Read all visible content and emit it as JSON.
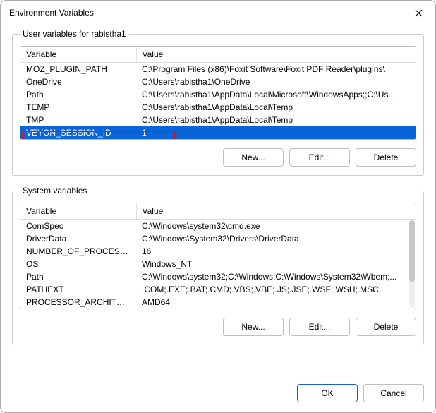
{
  "window": {
    "title": "Environment Variables"
  },
  "user_group": {
    "legend": "User variables for rabistha1",
    "columns": {
      "var": "Variable",
      "val": "Value"
    },
    "rows": [
      {
        "var": "MOZ_PLUGIN_PATH",
        "val": "C:\\Program Files (x86)\\Foxit Software\\Foxit PDF Reader\\plugins\\"
      },
      {
        "var": "OneDrive",
        "val": "C:\\Users\\rabistha1\\OneDrive"
      },
      {
        "var": "Path",
        "val": "C:\\Users\\rabistha1\\AppData\\Local\\Microsoft\\WindowsApps;;C:\\Us..."
      },
      {
        "var": "TEMP",
        "val": "C:\\Users\\rabistha1\\AppData\\Local\\Temp"
      },
      {
        "var": "TMP",
        "val": "C:\\Users\\rabistha1\\AppData\\Local\\Temp"
      },
      {
        "var": "VEYON_SESSION_ID",
        "val": "1"
      }
    ],
    "buttons": {
      "new": "New...",
      "edit": "Edit...",
      "delete": "Delete"
    }
  },
  "system_group": {
    "legend": "System variables",
    "columns": {
      "var": "Variable",
      "val": "Value"
    },
    "rows": [
      {
        "var": "ComSpec",
        "val": "C:\\Windows\\system32\\cmd.exe"
      },
      {
        "var": "DriverData",
        "val": "C:\\Windows\\System32\\Drivers\\DriverData"
      },
      {
        "var": "NUMBER_OF_PROCESSORS",
        "val": "16"
      },
      {
        "var": "OS",
        "val": "Windows_NT"
      },
      {
        "var": "Path",
        "val": "C:\\Windows\\system32;C:\\Windows;C:\\Windows\\System32\\Wbem;..."
      },
      {
        "var": "PATHEXT",
        "val": ".COM;.EXE;.BAT;.CMD;.VBS;.VBE;.JS;.JSE;.WSF;.WSH;.MSC"
      },
      {
        "var": "PROCESSOR_ARCHITECTURE",
        "val": "AMD64"
      }
    ],
    "buttons": {
      "new": "New...",
      "edit": "Edit...",
      "delete": "Delete"
    }
  },
  "footer": {
    "ok": "OK",
    "cancel": "Cancel"
  }
}
